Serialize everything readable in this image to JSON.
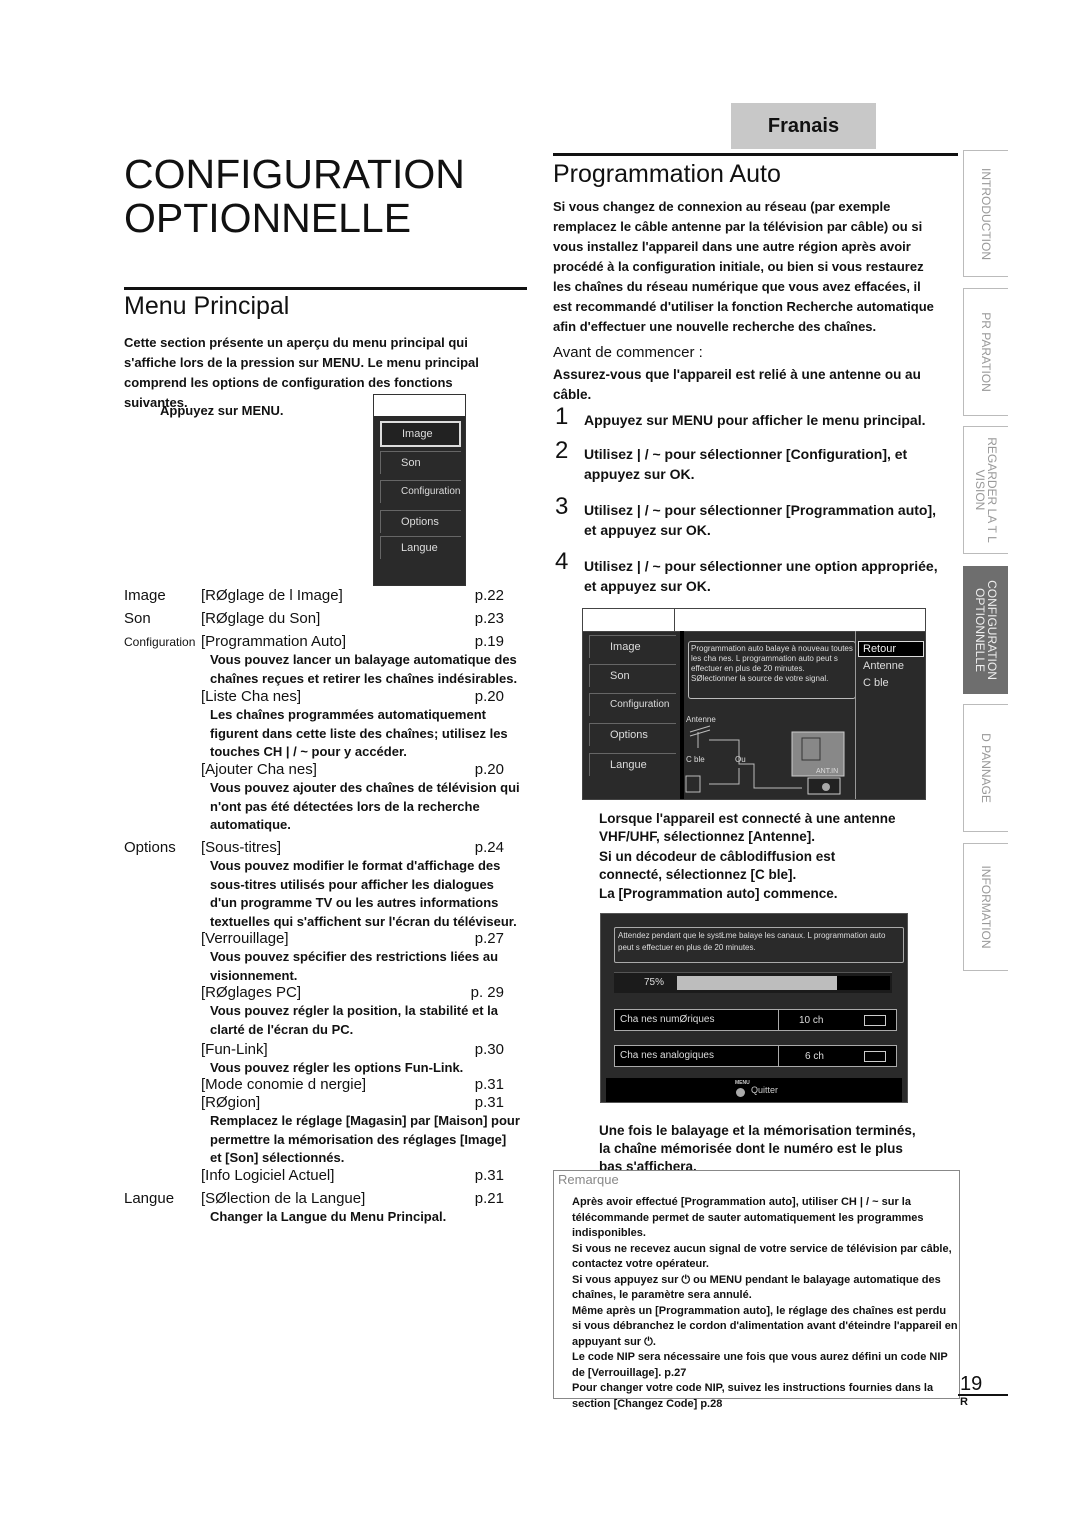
{
  "language_tab": "Franais",
  "page_title_line1": "CONFIGURATION",
  "page_title_line2": "OPTIONNELLE",
  "left": {
    "heading": "Menu Principal",
    "intro": "Cette section présente un aperçu du menu principal qui s'affiche lors de la pression sur MENU. Le menu principal comprend les options de configuration des fonctions suivantes.",
    "press_menu": "Appuyez sur MENU.",
    "menu_items": [
      "Image",
      "Son",
      "Configuration",
      "Options",
      "Langue"
    ],
    "rows": [
      {
        "cat": "Image",
        "item": "[RØglage de l Image]",
        "page": "p.22"
      },
      {
        "cat": "Son",
        "item": "[RØglage du Son]",
        "page": "p.23"
      },
      {
        "cat": "Configuration",
        "item": "[Programmation Auto]",
        "page": "p.19",
        "desc": "Vous pouvez lancer un balayage automatique des chaînes reçues et retirer les chaînes indésirables."
      },
      {
        "cat": "",
        "item": "[Liste Cha nes]",
        "page": "p.20",
        "desc": "Les chaînes programmées automatiquement figurent dans cette liste des chaînes; utilisez les touches CH | / ~ pour y accéder."
      },
      {
        "cat": "",
        "item": "[Ajouter Cha nes]",
        "page": "p.20",
        "desc": "Vous pouvez ajouter des chaînes de télévision qui n'ont pas été détectées lors de la recherche automatique."
      },
      {
        "cat": "Options",
        "item": "[Sous-titres]",
        "page": "p.24",
        "desc": "Vous pouvez modifier le format d'affichage des sous-titres utilisés pour afficher les dialogues d'un programme TV ou les autres informations textuelles qui s'affichent sur l'écran du téléviseur."
      },
      {
        "cat": "",
        "item": "[Verrouillage]",
        "page": "p.27",
        "desc": "Vous pouvez spécifier des restrictions liées au visionnement."
      },
      {
        "cat": "",
        "item": "[RØglages PC]",
        "page": "p. 29",
        "desc": "Vous pouvez régler la position, la stabilité et la clarté de l'écran du PC."
      },
      {
        "cat": "",
        "item": "[Fun-Link]",
        "page": "p.30",
        "desc": "Vous pouvez régler les options Fun-Link."
      },
      {
        "cat": "",
        "item": "[Mode conomie d nergie]",
        "page": "p.31"
      },
      {
        "cat": "",
        "item": "[RØgion]",
        "page": "p.31",
        "desc": "Remplacez le réglage [Magasin] par [Maison] pour permettre la mémorisation des réglages [Image] et [Son] sélectionnés."
      },
      {
        "cat": "",
        "item": "[Info Logiciel Actuel]",
        "page": "p.31"
      },
      {
        "cat": "Langue",
        "item": "[SØlection de la Langue]",
        "page": "p.21",
        "desc": "Changer la Langue du Menu Principal."
      }
    ]
  },
  "right": {
    "heading": "Programmation Auto",
    "intro": "Si vous changez de connexion au réseau (par exemple remplacez le câble antenne par la télévision par câble) ou si vous installez l'appareil dans une autre région après avoir procédé à la configuration initiale, ou bien si vous restaurez les chaînes du réseau numérique que vous avez effacées, il est recommandé d'utiliser la fonction Recherche automatique afin d'effectuer une nouvelle recherche des chaînes.",
    "before_label": "Avant de commencer :",
    "before_text": "Assurez-vous que l'appareil est relié à une antenne ou au câble.",
    "steps": [
      {
        "n": "1",
        "text": "Appuyez sur MENU pour afficher le menu principal."
      },
      {
        "n": "2",
        "text": "Utilisez | / ~ pour sélectionner [Configuration], et appuyez sur OK."
      },
      {
        "n": "3",
        "text": "Utilisez | / ~ pour sélectionner [Programmation auto], et appuyez sur OK."
      },
      {
        "n": "4",
        "text": "Utilisez | / ~ pour sélectionner une option appropriée, et appuyez sur OK."
      }
    ],
    "screen1": {
      "menu_items": [
        "Image",
        "Son",
        "Configuration",
        "Options",
        "Langue"
      ],
      "info": "Programmation auto balaye à nouveau toutes les cha nes. L programmation auto peut s effectuer en plus de 20 minutes. SØlectionner la source de votre signal.",
      "options": [
        "Retour",
        "Antenne",
        "C ble"
      ],
      "antenna_label": "Antenne",
      "cable_label": "C ble",
      "or_label": "Ou",
      "antin_label": "ANT.IN"
    },
    "after_step4": [
      "Lorsque l'appareil est connecté à une antenne VHF/UHF, sélectionnez [Antenne].",
      "Si un décodeur de câblodiffusion est connecté, sélectionnez [C ble].",
      "La [Programmation auto] commence."
    ],
    "screen2": {
      "message": "Attendez pendant que le systŁme balaye les canaux. L programmation auto peut s effectuer en plus de 20 minutes.",
      "progress_label": "75%",
      "progress": 0.75,
      "digital_label": "Cha nes numØriques",
      "digital_count": "10 ch",
      "analog_label": "Cha nes analogiques",
      "analog_count": "6 ch",
      "menu_tag": "MENU",
      "quit_label": "Quitter"
    },
    "done_text": "Une fois le balayage et la mémorisation terminés, la chaîne mémorisée dont le numéro est le plus bas s'affichera.",
    "note": {
      "title": "Remarque",
      "lines": [
        "Après avoir effectué [Programmation auto], utiliser CH | / ~ sur la",
        "télécommande permet de sauter automatiquement les programmes indisponibles.",
        "Si vous ne recevez aucun signal de votre service de télévision par câble,",
        "contactez votre opérateur.",
        "Si vous appuyez sur ⏻ ou MENU pendant le balayage automatique des",
        "chaînes, le paramètre sera annulé.",
        "Même après un [Programmation auto], le réglage des chaînes est perdu",
        "si vous débranchez le cordon d'alimentation avant d'éteindre l'appareil en",
        "appuyant sur ⏻.",
        "Le code NIP sera nécessaire une fois que vous aurez défini un code NIP",
        "de [Verrouillage]. p.27",
        "Pour changer votre code NIP, suivez les instructions fournies dans la",
        "section [Changez Code] p.28"
      ]
    }
  },
  "side_tabs": [
    "INTRODUCTION",
    "PR PARATION",
    "REGARDER LA T L VISION",
    "CONFIGURATION OPTIONNELLE",
    "D PANNAGE",
    "INFORMATION"
  ],
  "active_tab": "CONFIGURATION OPTIONNELLE",
  "page_number": "19",
  "page_suffix": "R"
}
